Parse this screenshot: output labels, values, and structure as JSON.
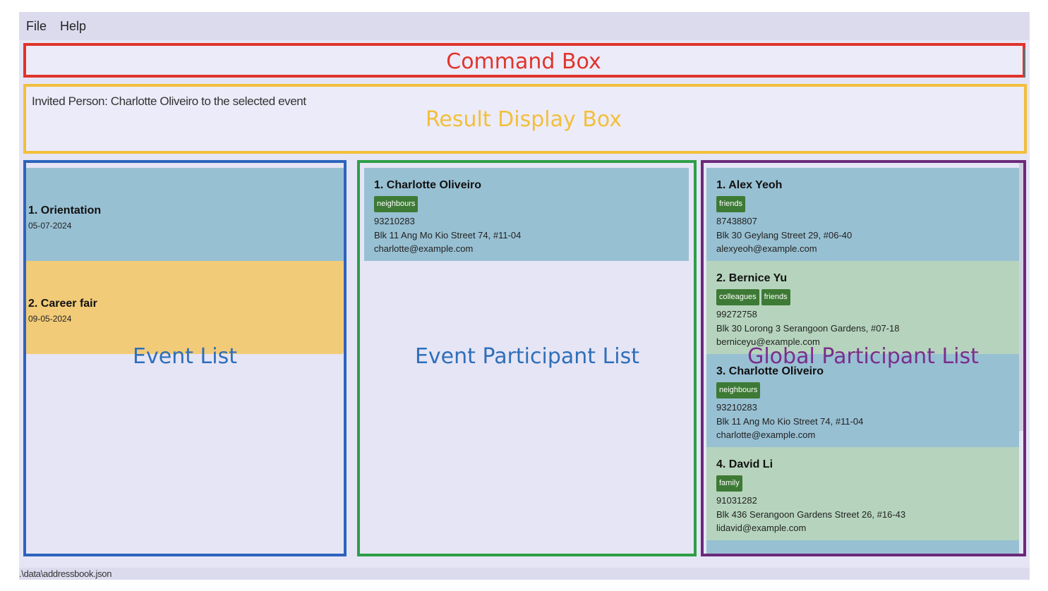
{
  "menu": {
    "file": "File",
    "help": "Help"
  },
  "command_box": {
    "value": "",
    "annotation": "Command Box"
  },
  "result_box": {
    "text": "Invited Person: Charlotte Oliveiro to the selected event",
    "annotation": "Result Display Box"
  },
  "event_list": {
    "annotation": "Event List",
    "events": [
      {
        "title": "1.  Orientation",
        "date": "05-07-2024"
      },
      {
        "title": "2.  Career fair",
        "date": "09-05-2024"
      }
    ]
  },
  "event_participant_list": {
    "annotation": "Event Participant List",
    "persons": [
      {
        "name": "1.  Charlotte Oliveiro",
        "tags": [
          "neighbours"
        ],
        "phone": "93210283",
        "address": "Blk 11 Ang Mo Kio Street 74, #11-04",
        "email": "charlotte@example.com"
      }
    ]
  },
  "global_participant_list": {
    "annotation": "Global Participant List",
    "persons": [
      {
        "name": "1.  Alex Yeoh",
        "tags": [
          "friends"
        ],
        "phone": "87438807",
        "address": "Blk 30 Geylang Street 29, #06-40",
        "email": "alexyeoh@example.com"
      },
      {
        "name": "2.  Bernice Yu",
        "tags": [
          "colleagues",
          "friends"
        ],
        "phone": "99272758",
        "address": "Blk 30 Lorong 3 Serangoon Gardens, #07-18",
        "email": "berniceyu@example.com"
      },
      {
        "name": "3.  Charlotte Oliveiro",
        "tags": [
          "neighbours"
        ],
        "phone": "93210283",
        "address": "Blk 11 Ang Mo Kio Street 74, #11-04",
        "email": "charlotte@example.com"
      },
      {
        "name": "4.  David Li",
        "tags": [
          "family"
        ],
        "phone": "91031282",
        "address": "Blk 436 Serangoon Gardens Street 26, #16-43",
        "email": "lidavid@example.com"
      }
    ]
  },
  "status_bar": {
    "path": ".\\data\\addressbook.json"
  },
  "colors": {
    "command_outline": "#e0342a",
    "result_outline": "#f2bf3b",
    "event_list_outline": "#2c64bd",
    "event_participant_outline": "#2e9e48",
    "global_participant_outline": "#6b2a7a",
    "card_blue": "#98c0d3",
    "card_green": "#b6d4bd",
    "card_yellow": "#f2cb78",
    "tag_green": "#3d7a35",
    "annotation_blue": "#2f6fba",
    "annotation_yellow": "#f2bf3b",
    "annotation_red": "#e0342a",
    "annotation_purple": "#7a2e8c"
  }
}
